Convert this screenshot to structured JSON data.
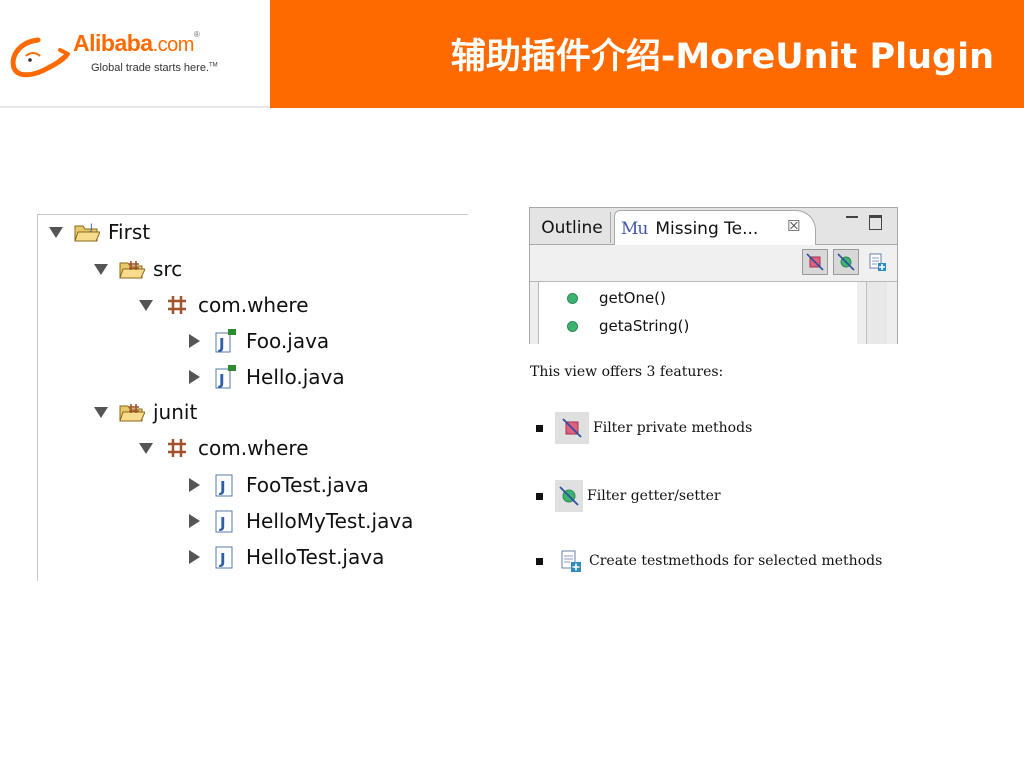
{
  "header": {
    "title": "辅助插件介绍-MoreUnit  Plugin",
    "logo": {
      "wordmark": "Alibaba",
      "domain": ".com",
      "registered": "®",
      "tagline": "Global trade starts here.",
      "trademark": "TM"
    }
  },
  "project_tree": {
    "items": [
      {
        "label": "First",
        "icon": "project-folder-icon",
        "expanded": true
      },
      {
        "label": "src",
        "icon": "source-folder-icon",
        "expanded": true
      },
      {
        "label": "com.where",
        "icon": "package-icon",
        "expanded": true
      },
      {
        "label": "Foo.java",
        "icon": "java-file-flagged-icon",
        "expanded": false
      },
      {
        "label": "Hello.java",
        "icon": "java-file-flagged-icon",
        "expanded": false
      },
      {
        "label": "junit",
        "icon": "source-folder-icon",
        "expanded": true
      },
      {
        "label": "com.where",
        "icon": "package-icon",
        "expanded": true
      },
      {
        "label": "FooTest.java",
        "icon": "java-file-icon",
        "expanded": false
      },
      {
        "label": "HelloMyTest.java",
        "icon": "java-file-icon",
        "expanded": false
      },
      {
        "label": "HelloTest.java",
        "icon": "java-file-icon",
        "expanded": false
      }
    ]
  },
  "missing_tests_view": {
    "tabs": {
      "outline": "Outline",
      "active_prefix": "Mu",
      "active": "Missing Te...",
      "close": "☒"
    },
    "toolbar": [
      "filter-private-icon",
      "filter-getter-setter-icon",
      "create-testmethods-icon"
    ],
    "methods": [
      "getOne()",
      "getaString()"
    ]
  },
  "features": {
    "intro": "This view offers 3 features:",
    "items": [
      {
        "label": "Filter private methods",
        "icon": "filter-private-icon"
      },
      {
        "label": "Filter getter/setter",
        "icon": "filter-getter-setter-icon"
      },
      {
        "label": "Create testmethods for selected methods",
        "icon": "create-testmethods-icon"
      }
    ]
  },
  "colors": {
    "banner": "#ff6a00",
    "method_dot": "#3cb371",
    "java_blue": "#2f5fa8",
    "package_brown": "#a0522d"
  }
}
